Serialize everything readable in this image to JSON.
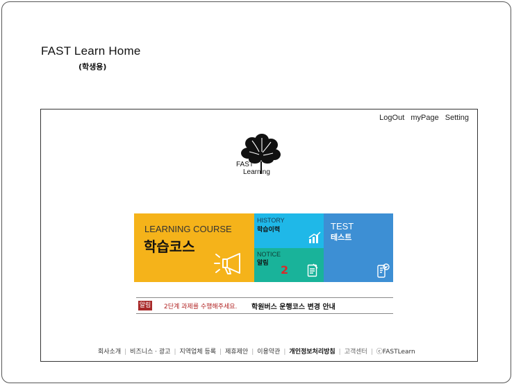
{
  "doc": {
    "title": "FAST Learn Home",
    "subtitle": "(학생용)"
  },
  "nav": {
    "logout": "LogOut",
    "mypage": "myPage",
    "setting": "Setting"
  },
  "logo": {
    "line1": "FAST",
    "line2": "Learning"
  },
  "tiles": {
    "learning": {
      "en": "LEARNING COURSE",
      "ko": "학습코스"
    },
    "history": {
      "en": "HISTORY",
      "ko": "학습이력"
    },
    "notice": {
      "en": "NOTICE",
      "ko": "알림",
      "count": "2"
    },
    "test": {
      "en": "TEST",
      "ko": "테스트"
    }
  },
  "alert": {
    "badge": "알림",
    "msg1": "2단계 과제를 수행해주세요.",
    "msg2": "학원버스 운행코스 변경 안내"
  },
  "footer": {
    "company": "회사소개",
    "business": "비즈니스 · 광고",
    "local": "지역업체 등록",
    "partner": "제휴제안",
    "terms": "이용약관",
    "privacy": "개인정보처리방침",
    "support": "고객센터",
    "copyright": "ⓒFASTLearn"
  },
  "colors": {
    "learning": "#f5b31a",
    "history": "#1fb8e8",
    "notice": "#19b39a",
    "test": "#3d8fd4",
    "alert": "#a82a2a"
  }
}
